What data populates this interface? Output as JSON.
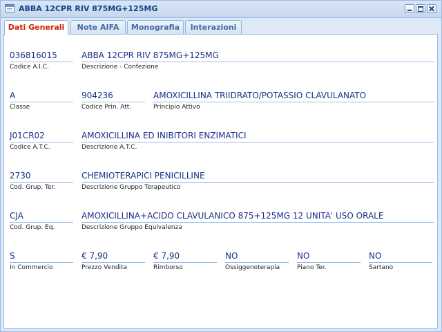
{
  "window": {
    "title": "ABBA 12CPR RIV 875MG+125MG"
  },
  "tabs": [
    {
      "label": "Dati Generali"
    },
    {
      "label": "Note AIFA"
    },
    {
      "label": "Monografia"
    },
    {
      "label": "Interazioni"
    }
  ],
  "active_tab": "Dati Generali",
  "fields": {
    "codice_aic": {
      "value": "036816015",
      "label": "Codice A.I.C."
    },
    "descrizione_confezione": {
      "value": "ABBA 12CPR RIV 875MG+125MG",
      "label": "Descrizione - Confezione"
    },
    "classe": {
      "value": "A",
      "label": "Classe"
    },
    "codice_prin_att": {
      "value": "904236",
      "label": "Codice Prin. Att."
    },
    "principio_attivo": {
      "value": "AMOXICILLINA TRIIDRATO/POTASSIO CLAVULANATO",
      "label": "Principio Attivo"
    },
    "codice_atc": {
      "value": "J01CR02",
      "label": "Codice A.T.C."
    },
    "descrizione_atc": {
      "value": "AMOXICILLINA ED INIBITORI ENZIMATICI",
      "label": "Descrizione A.T.C."
    },
    "cod_grup_ter": {
      "value": "2730",
      "label": "Cod. Grup. Ter."
    },
    "descrizione_gruppo_terapeutico": {
      "value": "CHEMIOTERAPICI PENICILLINE",
      "label": "Descrizione Gruppo Terapeutico"
    },
    "cod_grup_eq": {
      "value": "CJA",
      "label": "Cod. Grup. Eq."
    },
    "descrizione_gruppo_equivalenza": {
      "value": "AMOXICILLINA+ACIDO CLAVULANICO 875+125MG 12 UNITA' USO ORALE",
      "label": "Descrizione Gruppo Equivalenza"
    },
    "in_commercio": {
      "value": "S",
      "label": "In Commercio"
    },
    "prezzo_vendita": {
      "value": "€ 7,90",
      "label": "Prezzo Vendita"
    },
    "rimborso": {
      "value": "€ 7,90",
      "label": "Rimborso"
    },
    "ossigenoterapia": {
      "value": "NO",
      "label": "Ossiggenoterapia"
    },
    "piano_ter": {
      "value": "NO",
      "label": "Piano Ter."
    },
    "sartano": {
      "value": "NO",
      "label": "Sartano"
    }
  }
}
